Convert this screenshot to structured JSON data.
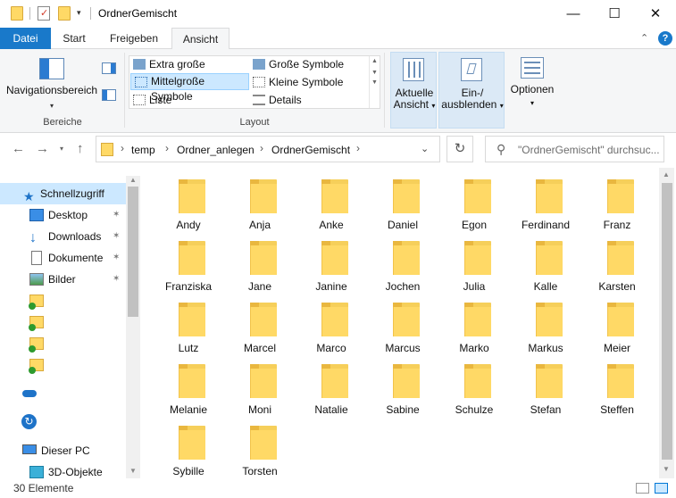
{
  "window": {
    "title": "OrdnerGemischt",
    "minimize_glyph": "—",
    "maximize_glyph": "☐",
    "close_glyph": "✕"
  },
  "ribbon": {
    "tabs": [
      {
        "label": "Datei"
      },
      {
        "label": "Start"
      },
      {
        "label": "Freigeben"
      },
      {
        "label": "Ansicht"
      }
    ],
    "active_tab": "Ansicht",
    "help_glyph": "?",
    "collapse_glyph": "⌃",
    "bereiche": {
      "nav_pane_label": "Navigationsbereich",
      "group_label": "Bereiche"
    },
    "layout": {
      "group_label": "Layout",
      "items": [
        {
          "label": "Extra große Symbole"
        },
        {
          "label": "Große Symbole"
        },
        {
          "label": "Mittelgroße Symbole"
        },
        {
          "label": "Kleine Symbole"
        },
        {
          "label": "Liste"
        },
        {
          "label": "Details"
        }
      ],
      "selected": "Mittelgroße Symbole"
    },
    "current_view": {
      "line1": "Aktuelle",
      "line2": "Ansicht"
    },
    "show_hide": {
      "line1": "Ein-/",
      "line2": "ausblenden"
    },
    "options": {
      "label": "Optionen"
    }
  },
  "address": {
    "breadcrumb": [
      "temp",
      "Ordner_anlegen",
      "OrdnerGemischt"
    ],
    "separator": "›",
    "refresh_glyph": "↻"
  },
  "search": {
    "placeholder": "\"OrdnerGemischt\" durchsuc..."
  },
  "navpane": {
    "items": [
      {
        "label": "Schnellzugriff",
        "icon": "star-icon"
      },
      {
        "label": "Desktop",
        "icon": "desktop-icon",
        "pinned": true
      },
      {
        "label": "Downloads",
        "icon": "download-icon",
        "pinned": true
      },
      {
        "label": "Dokumente",
        "icon": "document-icon",
        "pinned": true
      },
      {
        "label": "Bilder",
        "icon": "pictures-icon",
        "pinned": true
      },
      {
        "label": "",
        "icon": "synced-folder-icon"
      },
      {
        "label": "",
        "icon": "synced-folder-icon"
      },
      {
        "label": "",
        "icon": "synced-folder-icon"
      },
      {
        "label": "",
        "icon": "synced-folder-icon"
      },
      {
        "label": "",
        "icon": "onedrive-icon"
      },
      {
        "label": "",
        "icon": "sync-icon"
      },
      {
        "label": "Dieser PC",
        "icon": "computer-icon"
      },
      {
        "label": "3D-Objekte",
        "icon": "3d-objects-icon"
      }
    ],
    "pin_glyph": "✶"
  },
  "folders": [
    "Andy",
    "Anja",
    "Anke",
    "Daniel",
    "Egon",
    "Ferdinand",
    "Franz",
    "Franziska",
    "Jane",
    "Janine",
    "Jochen",
    "Julia",
    "Kalle",
    "Karsten",
    "Lutz",
    "Marcel",
    "Marco",
    "Marcus",
    "Marko",
    "Markus",
    "Meier",
    "Melanie",
    "Moni",
    "Natalie",
    "Sabine",
    "Schulze",
    "Stefan",
    "Steffen",
    "Sybille",
    "Torsten"
  ],
  "status": {
    "item_count": "30 Elemente"
  },
  "colors": {
    "accent": "#1979ca",
    "selection": "#cce8ff",
    "folder": "#ffd966"
  }
}
